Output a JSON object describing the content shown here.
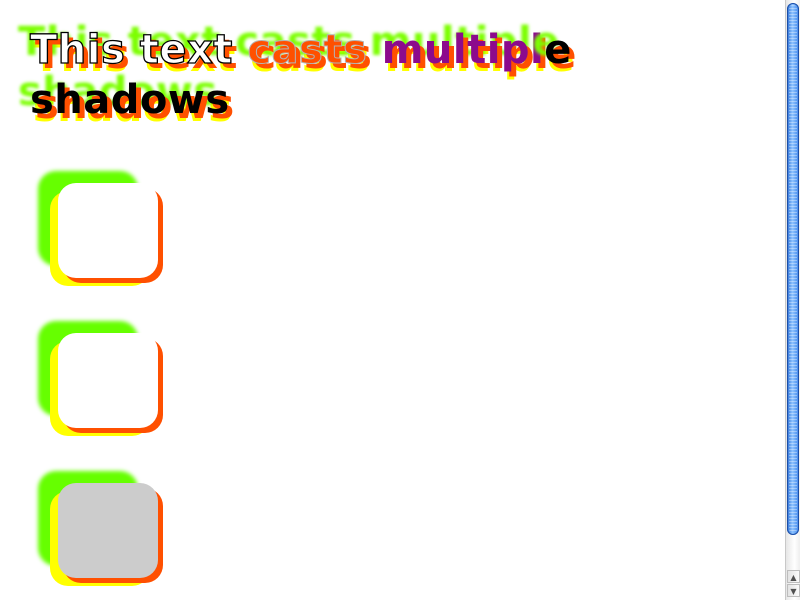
{
  "headline": {
    "words": [
      "This text",
      "casts",
      "multiple",
      "shadows"
    ]
  },
  "demo_boxes": [
    {
      "fill_color": "#ffffff"
    },
    {
      "fill_color": "#ffffff"
    },
    {
      "fill_color": "#cccccc"
    }
  ],
  "colors": {
    "shadow_orange": "#ff5000",
    "shadow_yellow": "#ffff00",
    "shadow_green": "#66ff00",
    "word_purple": "#8c0a8c",
    "scroll_thumb_blue": "#2a6fd6"
  },
  "scrollbar": {
    "up_icon": "scroll-up-arrow-icon",
    "down_icon": "scroll-down-arrow-icon",
    "up_glyph": "▲",
    "down_glyph": "▼"
  }
}
